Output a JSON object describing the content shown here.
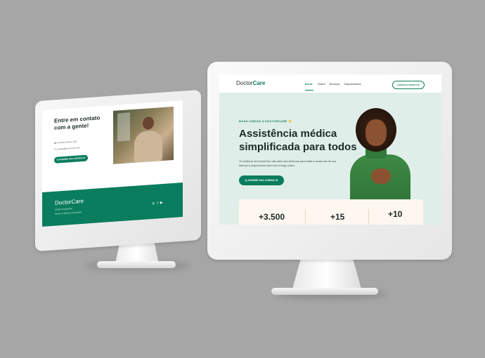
{
  "left_site": {
    "contact_title": "Entre em contato com a gente!",
    "address": "R. Nome da Rua, 000",
    "email": "contato@doctorcare.com",
    "button_label": "AGENDE SUA CONSULTA",
    "footer_logo": "DoctorCare",
    "footer_line1": "©2022 DoctorCare",
    "footer_line2": "Todos os direitos reservados",
    "social_icons": [
      "instagram-icon",
      "facebook-icon",
      "youtube-icon"
    ]
  },
  "right_site": {
    "logo_regular": "Doctor",
    "logo_bold": "Care",
    "nav": [
      {
        "label": "Início",
        "active": true
      },
      {
        "label": "Sobre",
        "active": false
      },
      {
        "label": "Serviços",
        "active": false
      },
      {
        "label": "Depoimentos",
        "active": false
      }
    ],
    "nav_cta": "AGENDAR CONSULTA",
    "welcome": "BOAS-VINDAS A DOCTORCARE 👋",
    "headline": "Assistência médica simplificada para todos",
    "paragraph": "Os médicos da DoctorCare vão além dos sintomas para tratar a causa raiz de sua doença e proporcionar uma cura a longo prazo.",
    "hero_button": "AGENDE SUA CONSULTA",
    "stats": [
      "+3.500",
      "+15",
      "+10"
    ]
  },
  "colors": {
    "brand": "#0a7d5e",
    "hero_bg": "#dfeee8",
    "stats_bg": "#fdf7ef",
    "background": "#a6a6a6"
  }
}
